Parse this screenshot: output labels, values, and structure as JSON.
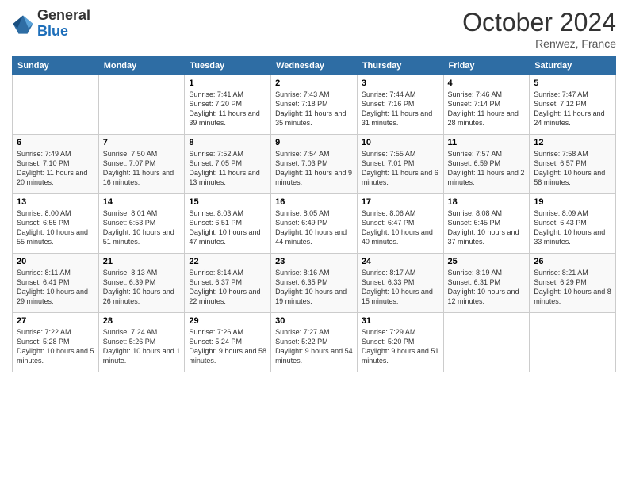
{
  "header": {
    "logo_general": "General",
    "logo_blue": "Blue",
    "month": "October 2024",
    "location": "Renwez, France"
  },
  "days_of_week": [
    "Sunday",
    "Monday",
    "Tuesday",
    "Wednesday",
    "Thursday",
    "Friday",
    "Saturday"
  ],
  "weeks": [
    [
      {
        "day": "",
        "info": ""
      },
      {
        "day": "",
        "info": ""
      },
      {
        "day": "1",
        "info": "Sunrise: 7:41 AM\nSunset: 7:20 PM\nDaylight: 11 hours and 39 minutes."
      },
      {
        "day": "2",
        "info": "Sunrise: 7:43 AM\nSunset: 7:18 PM\nDaylight: 11 hours and 35 minutes."
      },
      {
        "day": "3",
        "info": "Sunrise: 7:44 AM\nSunset: 7:16 PM\nDaylight: 11 hours and 31 minutes."
      },
      {
        "day": "4",
        "info": "Sunrise: 7:46 AM\nSunset: 7:14 PM\nDaylight: 11 hours and 28 minutes."
      },
      {
        "day": "5",
        "info": "Sunrise: 7:47 AM\nSunset: 7:12 PM\nDaylight: 11 hours and 24 minutes."
      }
    ],
    [
      {
        "day": "6",
        "info": "Sunrise: 7:49 AM\nSunset: 7:10 PM\nDaylight: 11 hours and 20 minutes."
      },
      {
        "day": "7",
        "info": "Sunrise: 7:50 AM\nSunset: 7:07 PM\nDaylight: 11 hours and 16 minutes."
      },
      {
        "day": "8",
        "info": "Sunrise: 7:52 AM\nSunset: 7:05 PM\nDaylight: 11 hours and 13 minutes."
      },
      {
        "day": "9",
        "info": "Sunrise: 7:54 AM\nSunset: 7:03 PM\nDaylight: 11 hours and 9 minutes."
      },
      {
        "day": "10",
        "info": "Sunrise: 7:55 AM\nSunset: 7:01 PM\nDaylight: 11 hours and 6 minutes."
      },
      {
        "day": "11",
        "info": "Sunrise: 7:57 AM\nSunset: 6:59 PM\nDaylight: 11 hours and 2 minutes."
      },
      {
        "day": "12",
        "info": "Sunrise: 7:58 AM\nSunset: 6:57 PM\nDaylight: 10 hours and 58 minutes."
      }
    ],
    [
      {
        "day": "13",
        "info": "Sunrise: 8:00 AM\nSunset: 6:55 PM\nDaylight: 10 hours and 55 minutes."
      },
      {
        "day": "14",
        "info": "Sunrise: 8:01 AM\nSunset: 6:53 PM\nDaylight: 10 hours and 51 minutes."
      },
      {
        "day": "15",
        "info": "Sunrise: 8:03 AM\nSunset: 6:51 PM\nDaylight: 10 hours and 47 minutes."
      },
      {
        "day": "16",
        "info": "Sunrise: 8:05 AM\nSunset: 6:49 PM\nDaylight: 10 hours and 44 minutes."
      },
      {
        "day": "17",
        "info": "Sunrise: 8:06 AM\nSunset: 6:47 PM\nDaylight: 10 hours and 40 minutes."
      },
      {
        "day": "18",
        "info": "Sunrise: 8:08 AM\nSunset: 6:45 PM\nDaylight: 10 hours and 37 minutes."
      },
      {
        "day": "19",
        "info": "Sunrise: 8:09 AM\nSunset: 6:43 PM\nDaylight: 10 hours and 33 minutes."
      }
    ],
    [
      {
        "day": "20",
        "info": "Sunrise: 8:11 AM\nSunset: 6:41 PM\nDaylight: 10 hours and 29 minutes."
      },
      {
        "day": "21",
        "info": "Sunrise: 8:13 AM\nSunset: 6:39 PM\nDaylight: 10 hours and 26 minutes."
      },
      {
        "day": "22",
        "info": "Sunrise: 8:14 AM\nSunset: 6:37 PM\nDaylight: 10 hours and 22 minutes."
      },
      {
        "day": "23",
        "info": "Sunrise: 8:16 AM\nSunset: 6:35 PM\nDaylight: 10 hours and 19 minutes."
      },
      {
        "day": "24",
        "info": "Sunrise: 8:17 AM\nSunset: 6:33 PM\nDaylight: 10 hours and 15 minutes."
      },
      {
        "day": "25",
        "info": "Sunrise: 8:19 AM\nSunset: 6:31 PM\nDaylight: 10 hours and 12 minutes."
      },
      {
        "day": "26",
        "info": "Sunrise: 8:21 AM\nSunset: 6:29 PM\nDaylight: 10 hours and 8 minutes."
      }
    ],
    [
      {
        "day": "27",
        "info": "Sunrise: 7:22 AM\nSunset: 5:28 PM\nDaylight: 10 hours and 5 minutes."
      },
      {
        "day": "28",
        "info": "Sunrise: 7:24 AM\nSunset: 5:26 PM\nDaylight: 10 hours and 1 minute."
      },
      {
        "day": "29",
        "info": "Sunrise: 7:26 AM\nSunset: 5:24 PM\nDaylight: 9 hours and 58 minutes."
      },
      {
        "day": "30",
        "info": "Sunrise: 7:27 AM\nSunset: 5:22 PM\nDaylight: 9 hours and 54 minutes."
      },
      {
        "day": "31",
        "info": "Sunrise: 7:29 AM\nSunset: 5:20 PM\nDaylight: 9 hours and 51 minutes."
      },
      {
        "day": "",
        "info": ""
      },
      {
        "day": "",
        "info": ""
      }
    ]
  ]
}
